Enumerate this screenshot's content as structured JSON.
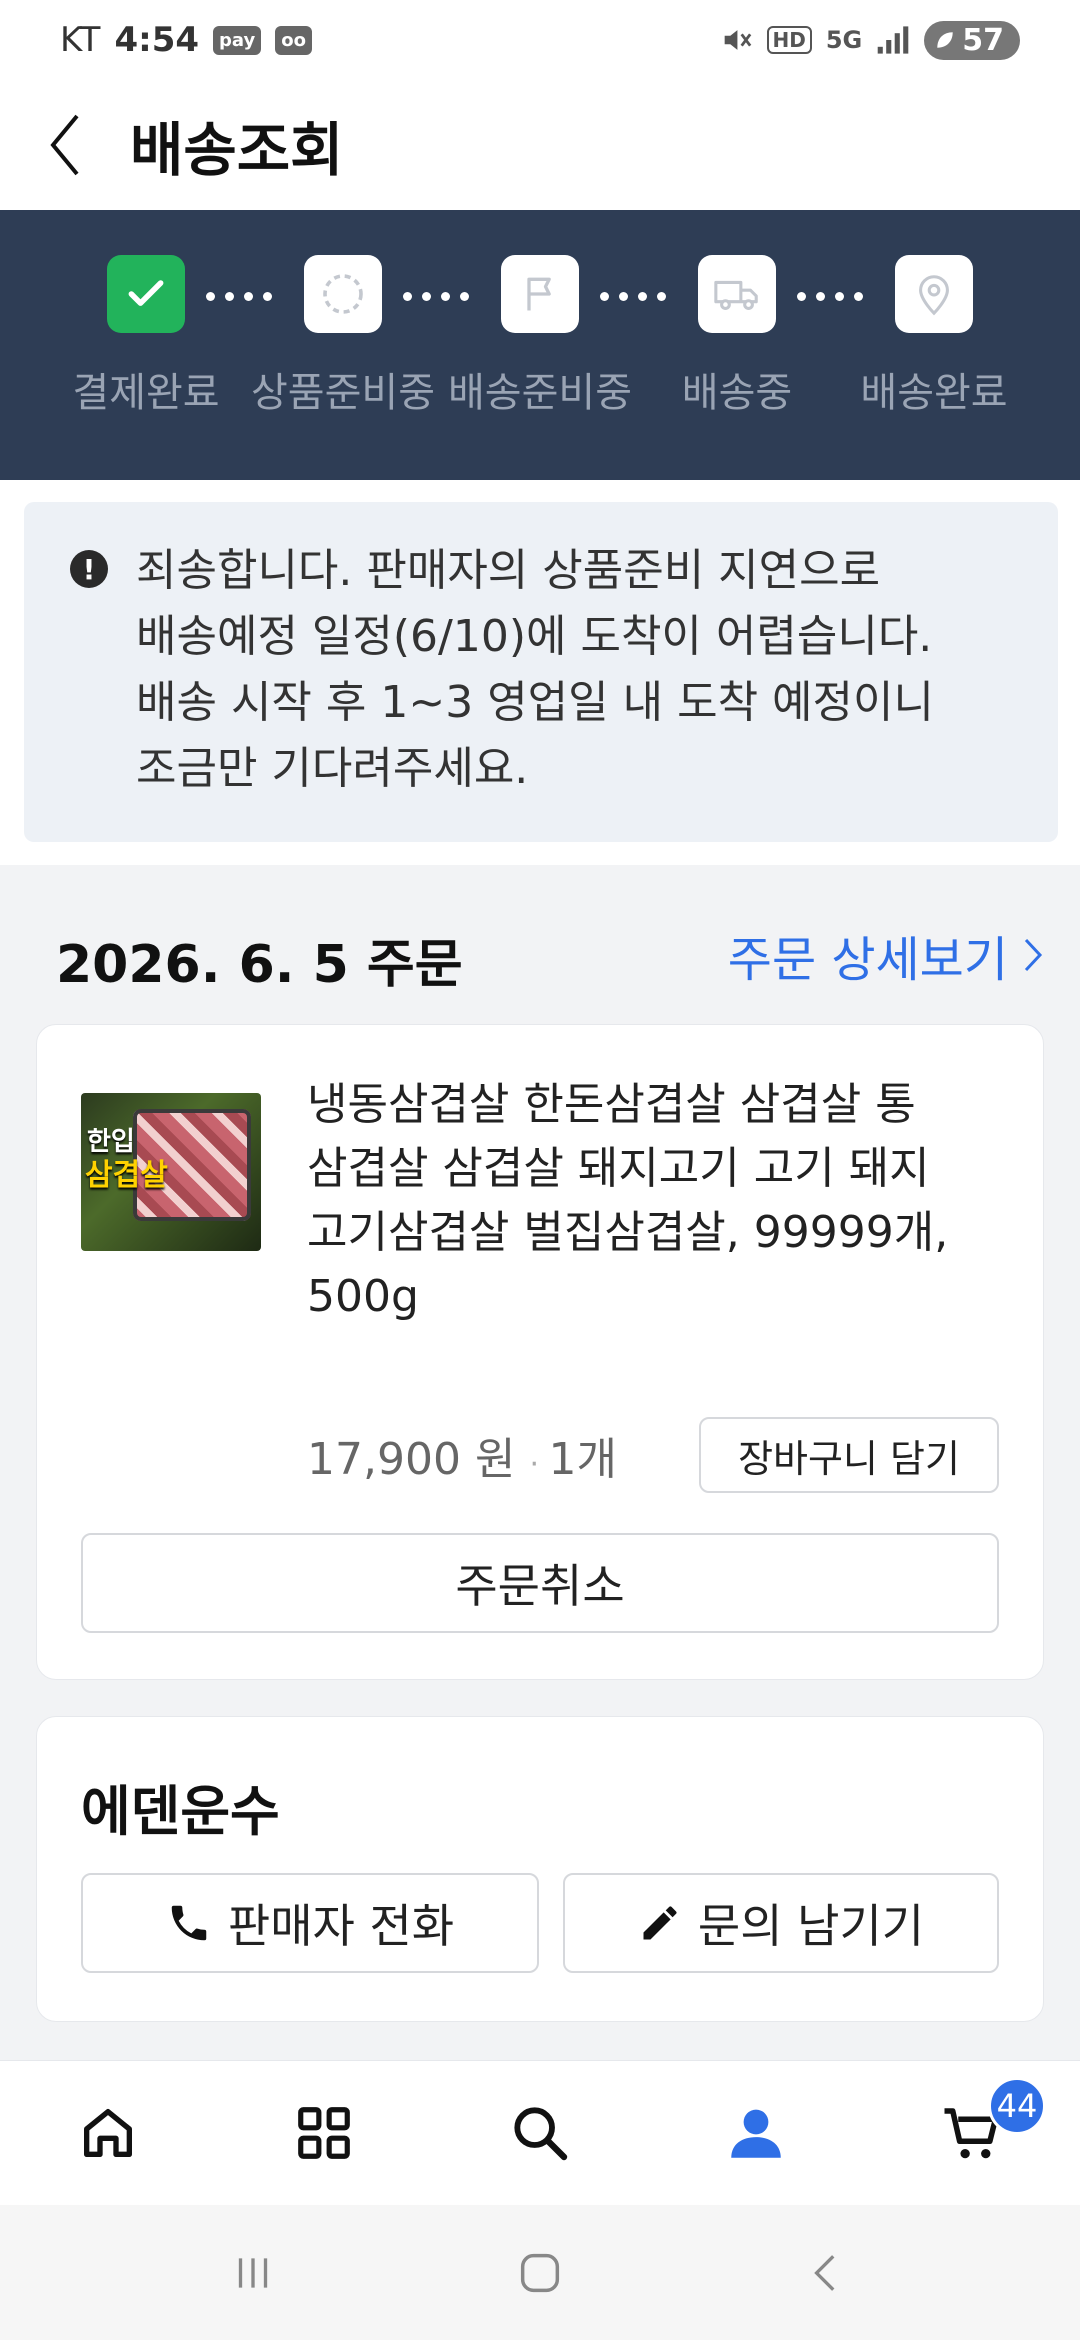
{
  "status_bar": {
    "carrier": "KT",
    "time": "4:54",
    "badges": [
      "pay",
      "oo"
    ],
    "network": "5G",
    "hd": "HD",
    "battery": "57"
  },
  "header": {
    "title": "배송조회"
  },
  "tracker": {
    "steps": [
      {
        "label": "결제완료",
        "icon": "check-icon",
        "done": true
      },
      {
        "label": "상품준비중",
        "icon": "spinner-icon",
        "done": false
      },
      {
        "label": "배송준비중",
        "icon": "flag-icon",
        "done": false
      },
      {
        "label": "배송중",
        "icon": "truck-icon",
        "done": false
      },
      {
        "label": "배송완료",
        "icon": "location-pin-icon",
        "done": false
      }
    ],
    "colors": {
      "background": "#2e3d55",
      "done": "#22b35b",
      "pending_label": "#9aa4b4"
    }
  },
  "notice": {
    "lines": [
      "죄송합니다. 판매자의 상품준비 지연으로",
      "배송예정 일정(6/10)에 도착이 어렵습니다.",
      "배송 시작 후 1~3 영업일 내 도착 예정이니",
      "조금만 기다려주세요."
    ]
  },
  "order": {
    "date": "2026. 6. 5 주문",
    "detail_link": "주문 상세보기",
    "product": {
      "name": "냉동삼겹살 한돈삼겹살 삼겹살 통삼겹살 삼겹살 돼지고기 고기 돼지고기삼겹살 벌집삼겹살, 99999개, 500g",
      "name_lines": [
        "냉동삼겹살 한돈삼겹살 삼겹살 통",
        "삼겹살 삼겹살 돼지고기 고기 돼지",
        "고기삼겹살 벌집삼겹살, 99999개,",
        "500g"
      ],
      "price": "17,900 원",
      "quantity": "1개",
      "thumb_text": [
        "한입",
        "삼겹살"
      ],
      "cart_button": "장바구니 담기"
    },
    "cancel_button": "주문취소"
  },
  "seller": {
    "name": "에덴운수",
    "call_button": "판매자 전화",
    "inquiry_button": "문의 남기기"
  },
  "bottom_nav": {
    "items": [
      "home-icon",
      "category-grid-icon",
      "search-icon",
      "my-page-icon",
      "cart-icon"
    ],
    "active": "my-page-icon",
    "cart_count": "44",
    "accent": "#2f6fe6"
  }
}
